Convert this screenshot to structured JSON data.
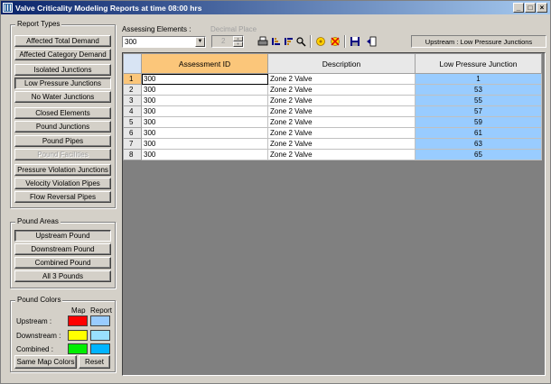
{
  "window": {
    "title": "Valve Criticality Modeling Reports at time 08:00 hrs",
    "min": "_",
    "max": "□",
    "close": "×"
  },
  "report_types": {
    "label": "Report Types",
    "buttons": [
      {
        "label": "Affected Total Demand",
        "state": "normal"
      },
      {
        "label": "Affected Category Demand",
        "state": "normal"
      },
      {
        "label": "Isolated Junctions",
        "state": "normal"
      },
      {
        "label": "Low Pressure Junctions",
        "state": "pressed"
      },
      {
        "label": "No Water Junctions",
        "state": "normal"
      },
      {
        "label": "Closed Elements",
        "state": "normal"
      },
      {
        "label": "Pound Junctions",
        "state": "normal"
      },
      {
        "label": "Pound Pipes",
        "state": "normal"
      },
      {
        "label": "Pound Facilities",
        "state": "disabled"
      },
      {
        "label": "Pressure Violation Junctions",
        "state": "normal"
      },
      {
        "label": "Velocity Violation Pipes",
        "state": "normal"
      },
      {
        "label": "Flow Reversal Pipes",
        "state": "normal"
      }
    ]
  },
  "pound_areas": {
    "label": "Pound Areas",
    "buttons": [
      {
        "label": "Upstream Pound",
        "state": "pressed"
      },
      {
        "label": "Downstream Pound",
        "state": "normal"
      },
      {
        "label": "Combined Pound",
        "state": "normal"
      },
      {
        "label": "All 3 Pounds",
        "state": "normal"
      }
    ]
  },
  "pound_colors": {
    "label": "Pound Colors",
    "col_map": "Map",
    "col_report": "Report",
    "rows": [
      {
        "label": "Upstream :",
        "map_color": "#ff0000",
        "report_color": "#99ccff"
      },
      {
        "label": "Downstream :",
        "map_color": "#ffff00",
        "report_color": "#99e0ff"
      },
      {
        "label": "Combined :",
        "map_color": "#00ee00",
        "report_color": "#00b4ff"
      }
    ],
    "same_map_colors": "Same Map Colors",
    "reset": "Reset"
  },
  "toolbar": {
    "assessing_label": "Assessing Elements :",
    "assessing_value": "300",
    "decimal_label": "Decimal Place",
    "decimal_value": "2",
    "status": "Upstream : Low Pressure Junctions",
    "icons": [
      "print-icon",
      "sort-ascending-icon",
      "sort-descending-icon",
      "find-icon",
      "highlight-icon",
      "clear-icon",
      "save-icon",
      "exit-icon"
    ]
  },
  "grid": {
    "headers": [
      "Assessment ID",
      "Description",
      "Low Pressure Junction"
    ],
    "rows": [
      {
        "n": "1",
        "id": "300",
        "desc": "Zone 2  Valve",
        "lpj": "1"
      },
      {
        "n": "2",
        "id": "300",
        "desc": "Zone 2  Valve",
        "lpj": "53"
      },
      {
        "n": "3",
        "id": "300",
        "desc": "Zone 2  Valve",
        "lpj": "55"
      },
      {
        "n": "4",
        "id": "300",
        "desc": "Zone 2  Valve",
        "lpj": "57"
      },
      {
        "n": "5",
        "id": "300",
        "desc": "Zone 2  Valve",
        "lpj": "59"
      },
      {
        "n": "6",
        "id": "300",
        "desc": "Zone 2  Valve",
        "lpj": "61"
      },
      {
        "n": "7",
        "id": "300",
        "desc": "Zone 2  Valve",
        "lpj": "63"
      },
      {
        "n": "8",
        "id": "300",
        "desc": "Zone 2  Valve",
        "lpj": "65"
      }
    ]
  }
}
